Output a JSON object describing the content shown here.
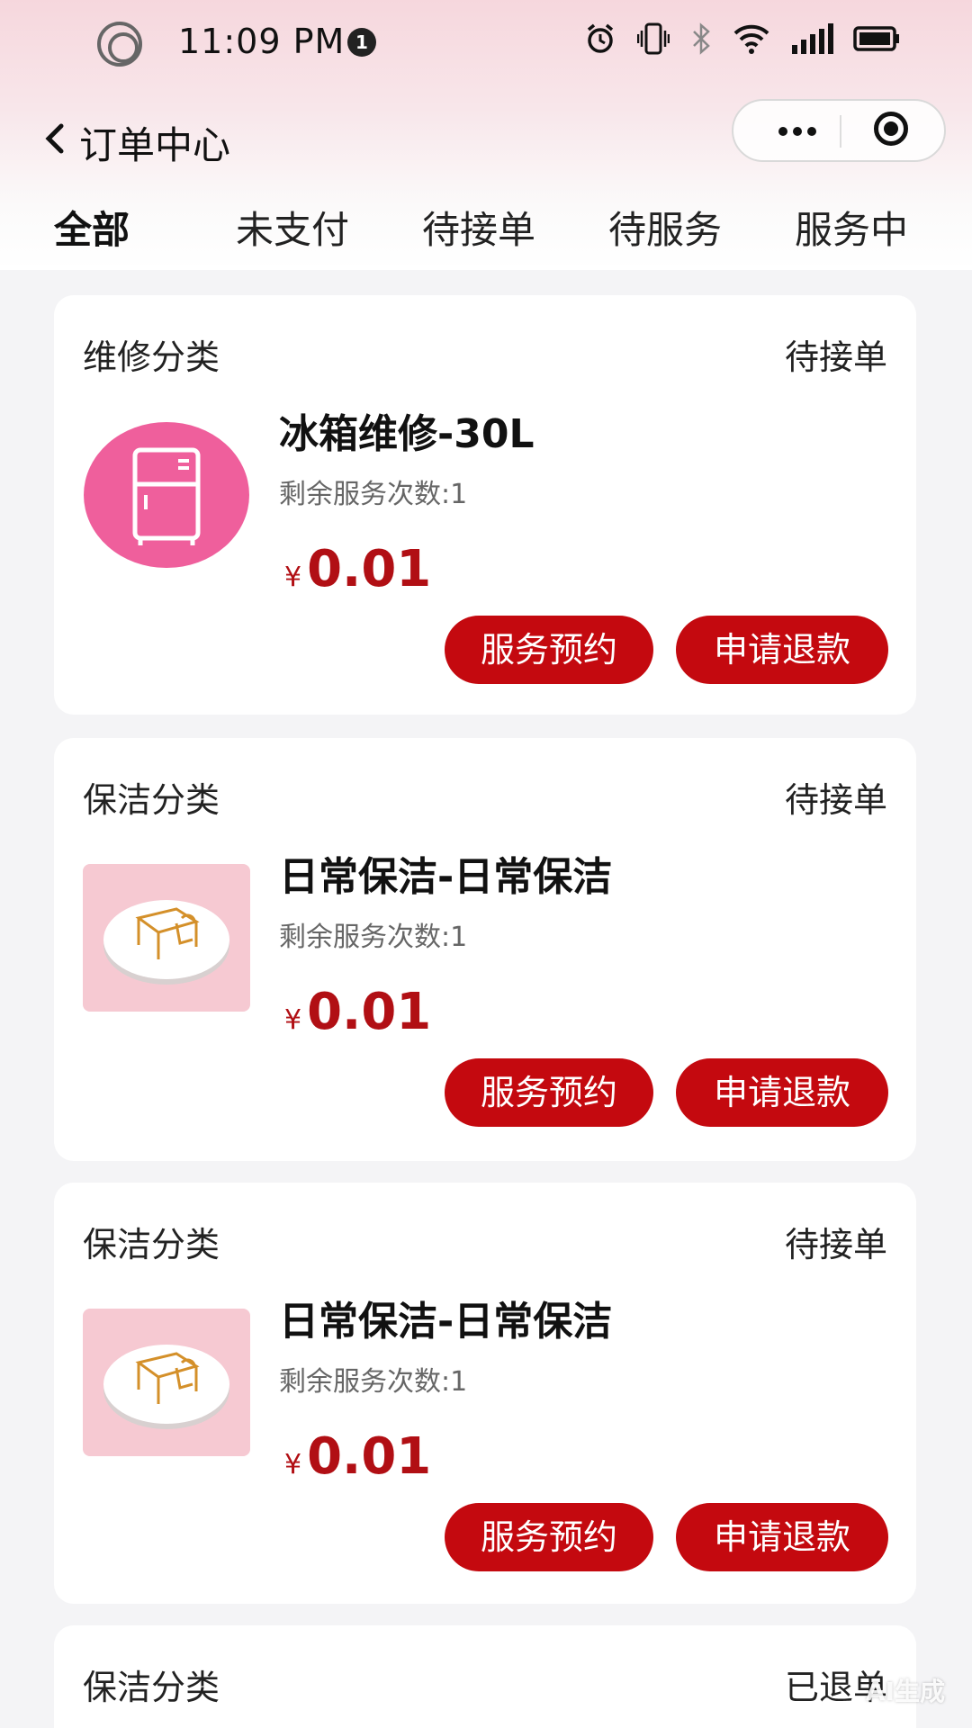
{
  "status_bar": {
    "time": "11:09 PM",
    "notification_count": "1",
    "icons": [
      "alarm-icon",
      "vibrate-icon",
      "bluetooth-icon",
      "wifi-icon",
      "signal-icon",
      "battery-icon"
    ]
  },
  "header": {
    "title": "订单中心",
    "back_icon": "chevron-left-icon",
    "more_icon": "more-dots-icon",
    "close_icon": "target-circle-icon"
  },
  "tabs": [
    {
      "label": "全部",
      "active": true
    },
    {
      "label": "未支付",
      "active": false
    },
    {
      "label": "待接单",
      "active": false
    },
    {
      "label": "待服务",
      "active": false
    },
    {
      "label": "服务中",
      "active": false
    }
  ],
  "orders": [
    {
      "category": "维修分类",
      "status": "待接单",
      "product_name": "冰箱维修-30L",
      "remaining": "剩余服务次数:1",
      "currency": "¥",
      "price": "0.01",
      "thumb_icon": "fridge-icon",
      "book_label": "服务预约",
      "refund_label": "申请退款"
    },
    {
      "category": "保洁分类",
      "status": "待接单",
      "product_name": "日常保洁-日常保洁",
      "remaining": "剩余服务次数:1",
      "currency": "¥",
      "price": "0.01",
      "thumb_icon": "desk-badge-icon",
      "book_label": "服务预约",
      "refund_label": "申请退款"
    },
    {
      "category": "保洁分类",
      "status": "待接单",
      "product_name": "日常保洁-日常保洁",
      "remaining": "剩余服务次数:1",
      "currency": "¥",
      "price": "0.01",
      "thumb_icon": "desk-badge-icon",
      "book_label": "服务预约",
      "refund_label": "申请退款"
    },
    {
      "category": "保洁分类",
      "status": "已退单"
    }
  ],
  "watermark": "AI生成",
  "colors": {
    "accent_red": "#c4090f",
    "price_red": "#b10f14",
    "fridge_pink": "#ef5f9c",
    "thumb_pink": "#f6c9d2"
  }
}
